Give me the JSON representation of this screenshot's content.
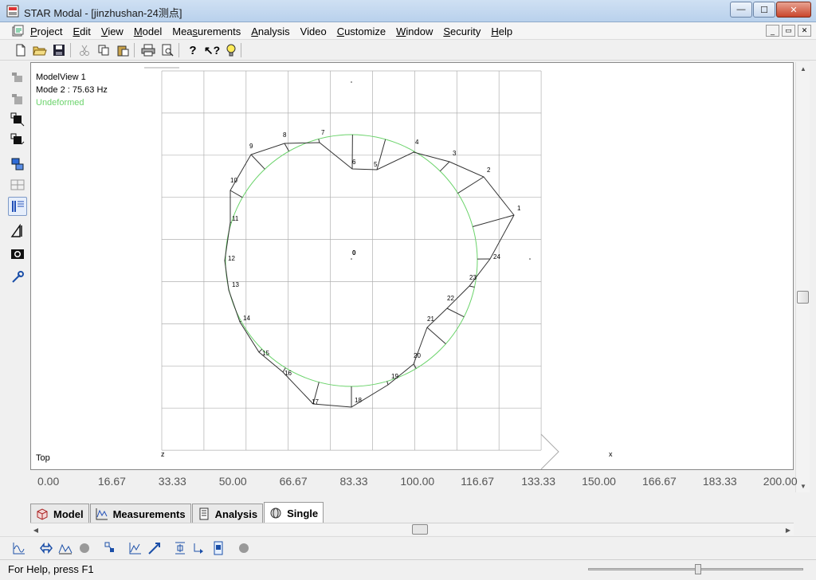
{
  "window": {
    "title": "STAR Modal - [jinzhushan-24测点]",
    "minimize": "—",
    "maximize": "☐",
    "close": "✕"
  },
  "menu": {
    "items": [
      {
        "label": "Project",
        "ul": "P",
        "rest": "roject"
      },
      {
        "label": "Edit",
        "ul": "E",
        "rest": "dit"
      },
      {
        "label": "View",
        "ul": "V",
        "rest": "iew"
      },
      {
        "label": "Model",
        "ul": "M",
        "rest": "odel"
      },
      {
        "label": "Measurements",
        "pre": "Mea",
        "ul": "s",
        "rest": "urements"
      },
      {
        "label": "Analysis",
        "ul": "A",
        "rest": "nalysis"
      },
      {
        "label": "Video",
        "ul": "",
        "rest": "Video"
      },
      {
        "label": "Customize",
        "ul": "C",
        "rest": "ustomize"
      },
      {
        "label": "Window",
        "ul": "W",
        "rest": "indow"
      },
      {
        "label": "Security",
        "ul": "S",
        "rest": "ecurity"
      },
      {
        "label": "Help",
        "ul": "H",
        "rest": "elp"
      }
    ],
    "mdi": [
      "_",
      "▭",
      "✕"
    ]
  },
  "viewport": {
    "name": "ModelView 1",
    "mode": "Mode 2 : 75.63 Hz",
    "state": "Undeformed",
    "orientation": "Top",
    "axis_z": "z",
    "axis_x": "x",
    "center_label": "0",
    "node_labels": [
      "1",
      "2",
      "3",
      "4",
      "5",
      "6",
      "7",
      "8",
      "9",
      "10",
      "11",
      "12",
      "13",
      "14",
      "15",
      "16",
      "17",
      "18",
      "19",
      "20",
      "21",
      "22",
      "23",
      "24"
    ]
  },
  "ruler": {
    "ticks": [
      "0.00",
      "16.67",
      "33.33",
      "50.00",
      "66.67",
      "83.33",
      "100.00",
      "116.67",
      "133.33",
      "150.00",
      "166.67",
      "183.33",
      "200.00"
    ]
  },
  "tabs": [
    {
      "label": "Model",
      "icon": "model-cube-icon"
    },
    {
      "label": "Measurements",
      "icon": "measurements-chart-icon"
    },
    {
      "label": "Analysis",
      "icon": "analysis-doc-icon"
    },
    {
      "label": "Single",
      "icon": "single-globe-icon"
    }
  ],
  "status": {
    "text": "For Help, press F1"
  },
  "colors": {
    "undeformed": "#6bd36b",
    "grid": "#b0b0b0",
    "model": "#333333"
  }
}
